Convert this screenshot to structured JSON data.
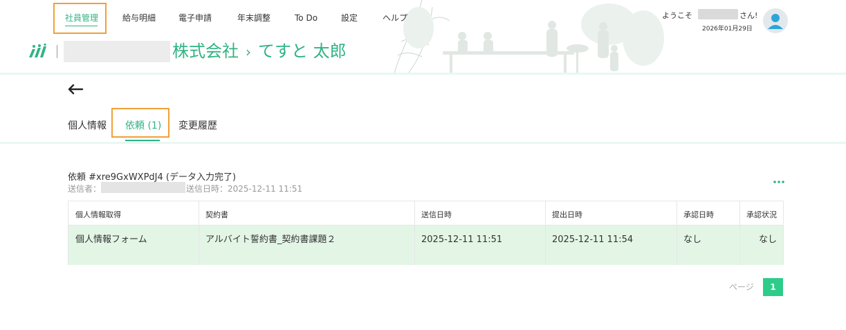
{
  "nav": {
    "items": [
      {
        "label": "社員管理",
        "active": true
      },
      {
        "label": "給与明細"
      },
      {
        "label": "電子申請"
      },
      {
        "label": "年末調整"
      },
      {
        "label": "To Do"
      },
      {
        "label": "設定"
      },
      {
        "label": "ヘルプ"
      }
    ]
  },
  "user": {
    "welcome_prefix": "ようこそ",
    "welcome_suffix": "さん!",
    "date": "2026年01月29日"
  },
  "header": {
    "company_suffix": "株式会社",
    "separator": "›",
    "employee_name": "てすと 太郎"
  },
  "tabs": [
    {
      "label": "個人情報"
    },
    {
      "label": "依頼 (1)",
      "active": true
    },
    {
      "label": "変更履歴"
    }
  ],
  "request": {
    "title": "依頼 #xre9GxWXPdJ4 (データ入力完了)",
    "sender_label": "送信者：",
    "sent_at_label": "送信日時：2025-12-11 11:51"
  },
  "table": {
    "headers": [
      "個人情報取得",
      "契約書",
      "送信日時",
      "提出日時",
      "承認日時",
      "承認状況"
    ],
    "rows": [
      [
        "個人情報フォーム",
        "アルバイト誓約書_契約書課題２",
        "2025-12-11 11:51",
        "2025-12-11 11:54",
        "なし",
        "なし"
      ]
    ]
  },
  "pagination": {
    "label": "ページ",
    "current": "1"
  },
  "colors": {
    "accent": "#2fb383",
    "highlight_box": "#f0a038",
    "row_bg": "#e3f6e6",
    "page_btn": "#2ecc8a"
  },
  "icons": [
    "logo-icon",
    "avatar-icon",
    "back-arrow-icon",
    "more-dots-icon"
  ]
}
